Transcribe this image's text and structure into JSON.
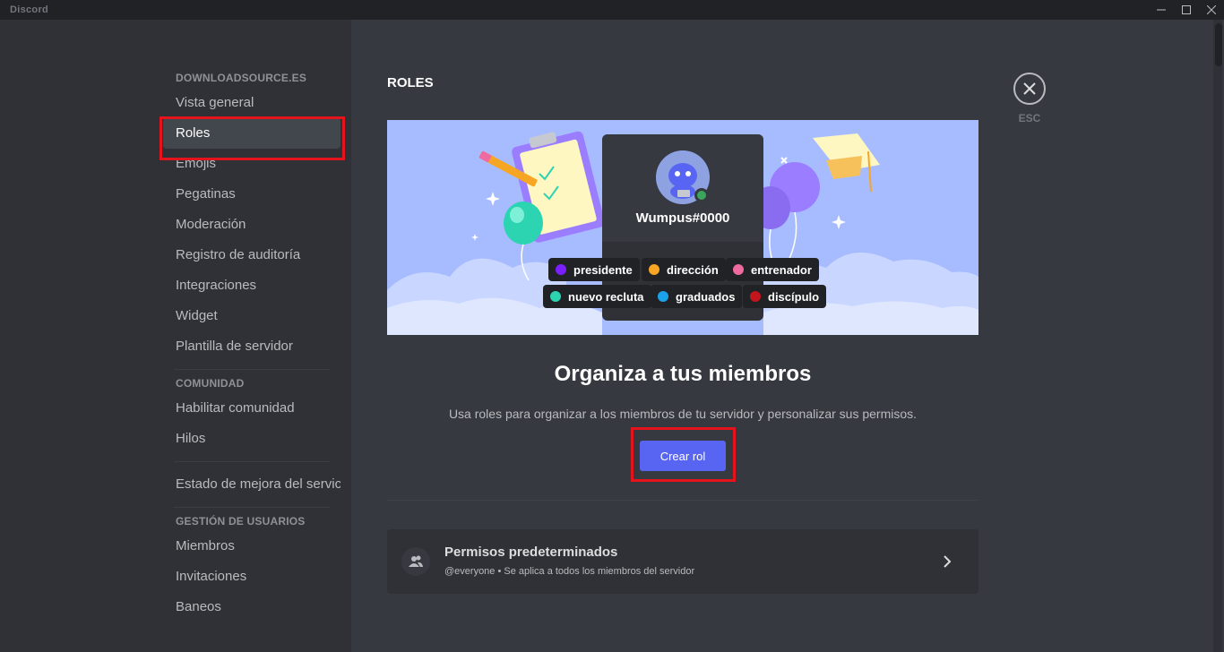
{
  "window": {
    "title": "Discord"
  },
  "sidebar": {
    "sections": [
      {
        "header": "DOWNLOADSOURCE.ES",
        "items": [
          "Vista general",
          "Roles",
          "Emojis",
          "Pegatinas",
          "Moderación",
          "Registro de auditoría",
          "Integraciones",
          "Widget",
          "Plantilla de servidor"
        ]
      },
      {
        "header": "COMUNIDAD",
        "items": [
          "Habilitar comunidad",
          "Hilos"
        ]
      },
      {
        "header": "",
        "items": [
          "Estado de mejora del servic"
        ]
      },
      {
        "header": "GESTIÓN DE USUARIOS",
        "items": [
          "Miembros",
          "Invitaciones",
          "Baneos"
        ]
      }
    ],
    "selected": "Roles"
  },
  "main": {
    "title": "ROLES",
    "banner": {
      "username": "Wumpus#0000",
      "roles": [
        {
          "name": "presidente",
          "color": "#7b1fff"
        },
        {
          "name": "dirección",
          "color": "#f6a623"
        },
        {
          "name": "entrenador",
          "color": "#ef6aa0"
        },
        {
          "name": "nuevo recluta",
          "color": "#2dd4b1"
        },
        {
          "name": "graduados",
          "color": "#1aa3ea"
        },
        {
          "name": "discípulo",
          "color": "#c3151c"
        }
      ]
    },
    "headline": "Organiza a tus miembros",
    "subline": "Usa roles para organizar a los miembros de tu servidor y personalizar sus permisos.",
    "create_button": "Crear rol",
    "permissions": {
      "title": "Permisos predeterminados",
      "subtitle": "@everyone • Se aplica a todos los miembros del servidor"
    },
    "close": {
      "label": "ESC"
    }
  },
  "colors": {
    "background": "#36393f",
    "sidebar": "#2f3136",
    "accent": "#5865f2",
    "highlight": "#e5141c"
  }
}
